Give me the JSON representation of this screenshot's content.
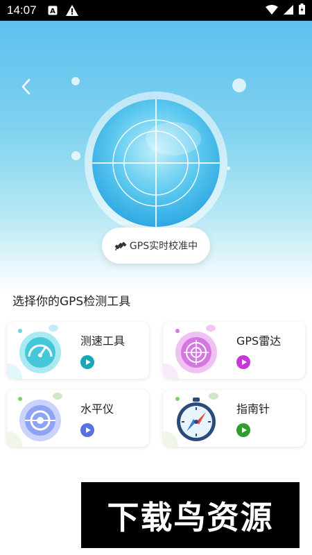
{
  "status_bar": {
    "time": "14:07",
    "left_icons": [
      "a-box-icon",
      "warning-icon"
    ],
    "right_icons": [
      "wifi-icon",
      "signal-icon",
      "battery-icon"
    ]
  },
  "header": {
    "back_icon": "chevron-left-icon",
    "calibration_label": "GPS实时校准中",
    "calibration_icon": "satellite-icon"
  },
  "section_title": "选择你的GPS检测工具",
  "tools": [
    {
      "label": "测速工具",
      "icon": "speedometer-icon",
      "accent": "#1aa6b8"
    },
    {
      "label": "GPS雷达",
      "icon": "radar-icon",
      "accent": "#c43ad6"
    },
    {
      "label": "水平仪",
      "icon": "level-icon",
      "accent": "#5672e0"
    },
    {
      "label": "指南针",
      "icon": "compass-icon",
      "accent": "#2f9e2f"
    }
  ],
  "watermark": "下载鸟资源"
}
